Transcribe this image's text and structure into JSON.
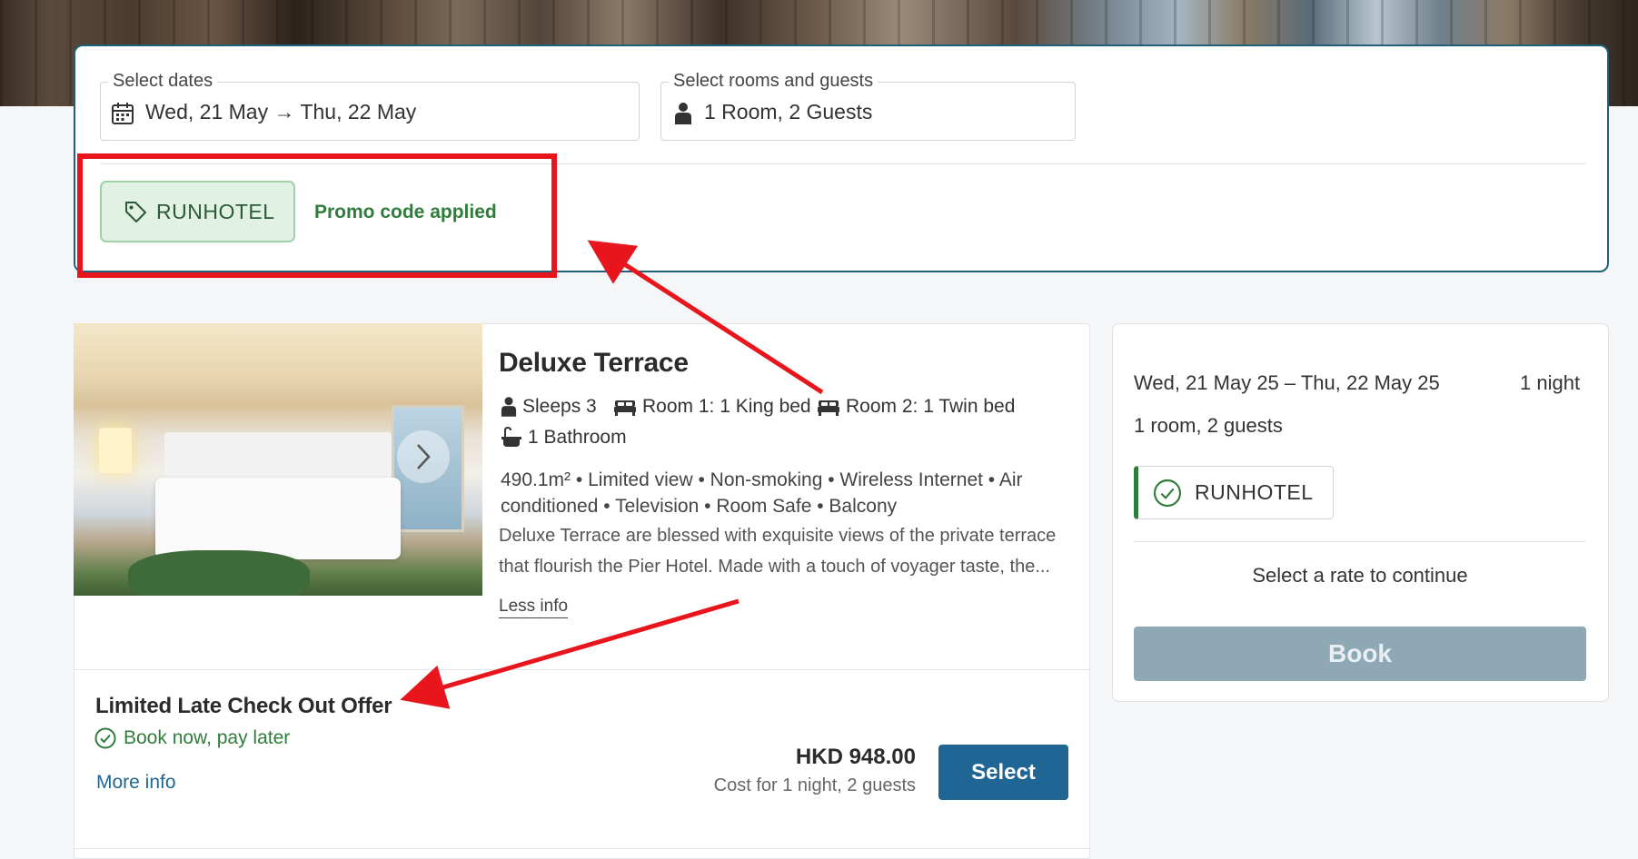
{
  "colors": {
    "accent": "#1f6694",
    "panel_border": "#1f5f7a",
    "success": "#2f7d3a",
    "promo_chip_bg": "#e1f2e4",
    "annotation": "#e8161c",
    "book_disabled": "#8ea9b5"
  },
  "search": {
    "dates_label": "Select dates",
    "dates_value": "Wed, 21 May → Thu, 22 May",
    "dates_icon": "calendar-icon",
    "rooms_label": "Select rooms and guests",
    "rooms_value": "1 Room, 2 Guests",
    "rooms_icon": "person-icon",
    "promo_code": "RUNHOTEL",
    "promo_icon": "tag-icon",
    "promo_status": "Promo code applied"
  },
  "room": {
    "title": "Deluxe Terrace",
    "sleeps": "Sleeps 3",
    "room1_bed": "Room 1: 1 King bed",
    "room2_bed": "Room 2: 1 Twin bed",
    "bathroom": "1 Bathroom",
    "amenities": [
      "490.1m²",
      "Limited view",
      "Non-smoking",
      "Wireless Internet",
      "Air",
      "conditioned",
      "Television",
      "Room Safe",
      "Balcony"
    ],
    "description_line1": "Deluxe Terrace are blessed with exquisite views of the private terrace",
    "description_line2": "that flourish the Pier Hotel. Made with a touch of voyager taste, the...",
    "less_info": "Less info"
  },
  "offer": {
    "title": "Limited Late Check Out Offer",
    "pay_later": "Book now, pay later",
    "more_info": "More info",
    "price": "HKD 948.00",
    "price_note": "Cost for 1 night, 2 guests",
    "select_label": "Select"
  },
  "summary": {
    "dates": "Wed, 21 May 25 – Thu, 22 May 25",
    "nights": "1 night",
    "guests": "1 room, 2 guests",
    "promo_code": "RUNHOTEL",
    "continue_text": "Select a rate to continue",
    "book_label": "Book"
  }
}
